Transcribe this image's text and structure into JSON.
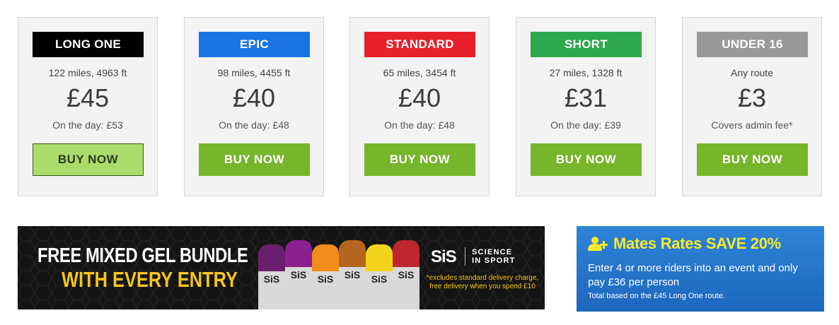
{
  "tiers": [
    {
      "name": "LONG ONE",
      "distance": "122 miles, 4963 ft",
      "price": "£45",
      "note": "On the day: £53",
      "button": "BUY NOW",
      "color": "#000000"
    },
    {
      "name": "EPIC",
      "distance": "98 miles, 4455 ft",
      "price": "£40",
      "note": "On the day: £48",
      "button": "BUY NOW",
      "color": "#1b74e4"
    },
    {
      "name": "STANDARD",
      "distance": "65 miles, 3454 ft",
      "price": "£40",
      "note": "On the day: £48",
      "button": "BUY NOW",
      "color": "#e8202a"
    },
    {
      "name": "SHORT",
      "distance": "27 miles, 1328 ft",
      "price": "£31",
      "note": "On the day: £39",
      "button": "BUY NOW",
      "color": "#2ea84f"
    },
    {
      "name": "UNDER 16",
      "distance": "Any route",
      "price": "£3",
      "note": "Covers admin fee*",
      "button": "BUY NOW",
      "color": "#999999"
    }
  ],
  "colors": {
    "buy_button": "#77b52b",
    "buy_button_hover": "#a9dc6a",
    "gel_accent": "#f5c518",
    "mates_accent": "#f7ea2c",
    "mates_bg": "#2478cc"
  },
  "gel_banner": {
    "line1": "FREE MIXED GEL BUNDLE",
    "line2": "WITH EVERY ENTRY",
    "brand_logo": "SiS",
    "brand_name_1": "SCIENCE",
    "brand_name_2": "IN SPORT",
    "disclaimer": "*excludes standard delivery charge, free delivery when you spend £10",
    "gel_label": "SiS",
    "gel_colors": [
      "#6a1f6e",
      "#8a1f8f",
      "#f28c1a",
      "#b5651d",
      "#f2d21a",
      "#c0262d"
    ]
  },
  "mates": {
    "icon": "add-user-icon",
    "title": "Mates Rates SAVE 20%",
    "body": "Enter 4 or more riders into an event and only pay £36 per person",
    "footnote": "Total based on the £45 Long One route."
  }
}
